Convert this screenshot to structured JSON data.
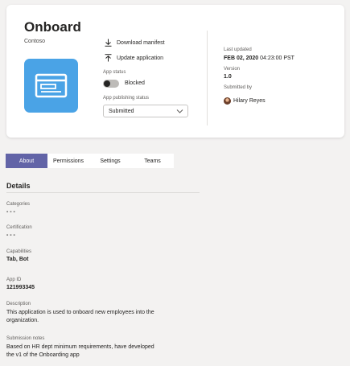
{
  "app": {
    "title": "Onboard",
    "publisher": "Contoso"
  },
  "actions": {
    "download_manifest": "Download manifest",
    "update_application": "Update application"
  },
  "app_status": {
    "label": "App status",
    "value": "Blocked",
    "enabled": false
  },
  "publishing_status": {
    "label": "App publishing status",
    "selected": "Submitted"
  },
  "meta": {
    "last_updated_label": "Last updated",
    "last_updated_date": "FEB 02, 2020",
    "last_updated_time": "04:23:00 PST",
    "version_label": "Version",
    "version_value": "1.0",
    "submitted_by_label": "Submitted by",
    "submitted_by_value": "Hilary Reyes"
  },
  "tabs": [
    {
      "label": "About",
      "active": true
    },
    {
      "label": "Permissions",
      "active": false
    },
    {
      "label": "Settings",
      "active": false
    },
    {
      "label": "Teams",
      "active": false
    }
  ],
  "details": {
    "title": "Details",
    "categories_label": "Categories",
    "categories_value": "- - -",
    "certification_label": "Certification",
    "certification_value": "- - -",
    "capabilities_label": "Capabilities",
    "capabilities_value": "Tab, Bot",
    "app_id_label": "App ID",
    "app_id_value": "121993345",
    "description_label": "Description",
    "description_value": "This application is used to onboard new employees into the organization.",
    "submission_notes_label": "Submission notes",
    "submission_notes_value": "Based on HR dept minimum requirements, have developed the v1 of the Onboarding app"
  },
  "colors": {
    "accent": "#6264a7",
    "app_icon_bg": "#4aa3e6",
    "page_bg": "#f3f2f1"
  }
}
